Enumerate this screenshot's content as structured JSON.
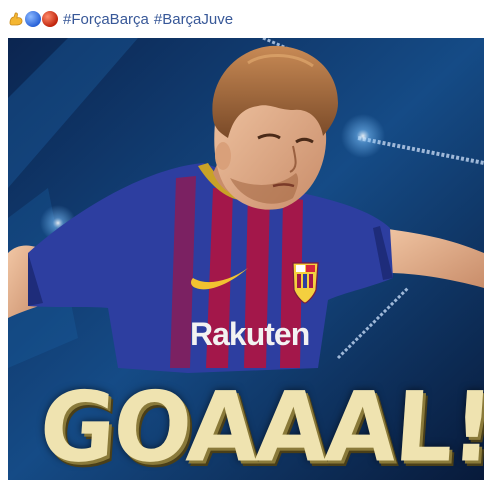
{
  "post": {
    "emojis": [
      "flexed-biceps-icon",
      "blue-circle-icon",
      "red-circle-icon"
    ],
    "hashtags": [
      "#ForçaBarça",
      "#BarçaJuve"
    ]
  },
  "media": {
    "headline": "GOAAAL!!!",
    "shirt_sponsor": "Rakuten"
  },
  "colors": {
    "link": "#385898",
    "shirt_blue": "#2d3ea0",
    "shirt_garnet": "#a3174a",
    "headline": "#efe3b0",
    "background": "#0d2b5a"
  }
}
